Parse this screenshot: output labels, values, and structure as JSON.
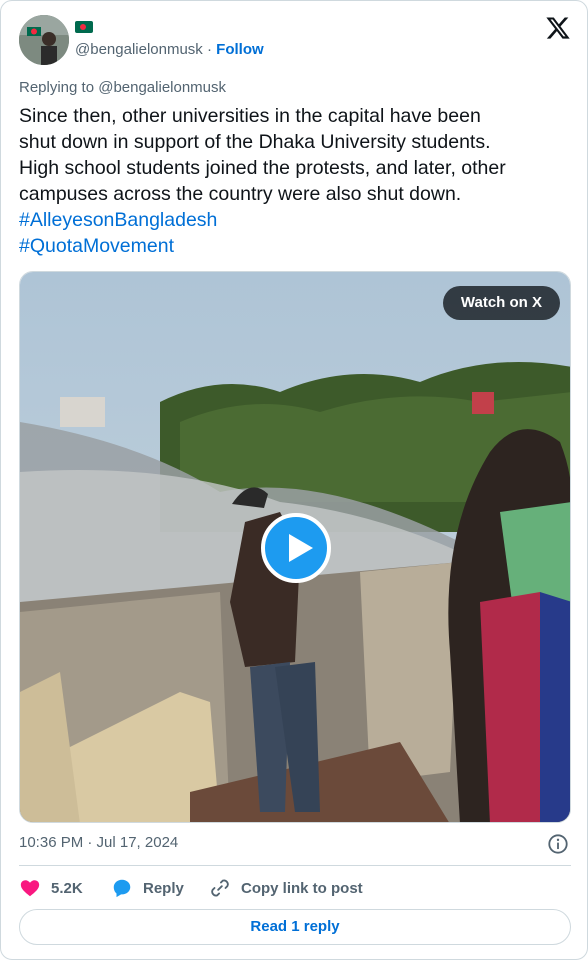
{
  "author": {
    "handle": "@bengalielonmusk",
    "separator": "·",
    "follow_label": "Follow",
    "flag_icon": "bangladesh-flag-icon"
  },
  "platform_icon": "x-logo-icon",
  "reply_context": "Replying to @bengalielonmusk",
  "tweet": {
    "text_lines": [
      "Since then, other universities in the capital have been",
      "shut down in support of the Dhaka University students.",
      "High school students joined the protests, and later, other",
      "campuses across the country were also shut down."
    ],
    "hashtags": [
      "#AlleyesonBangladesh",
      "#QuotaMovement"
    ]
  },
  "media": {
    "watch_label": "Watch on X",
    "play_icon": "play-icon"
  },
  "timestamp": "10:36 PM · Jul 17, 2024",
  "info_icon": "info-icon",
  "actions": {
    "likes_count": "5.2K",
    "reply_label": "Reply",
    "copy_link_label": "Copy link to post"
  },
  "read_reply_label": "Read 1 reply",
  "colors": {
    "link": "#006fd6",
    "like": "#f91880",
    "reply": "#1d9bf0",
    "muted": "#536471"
  }
}
